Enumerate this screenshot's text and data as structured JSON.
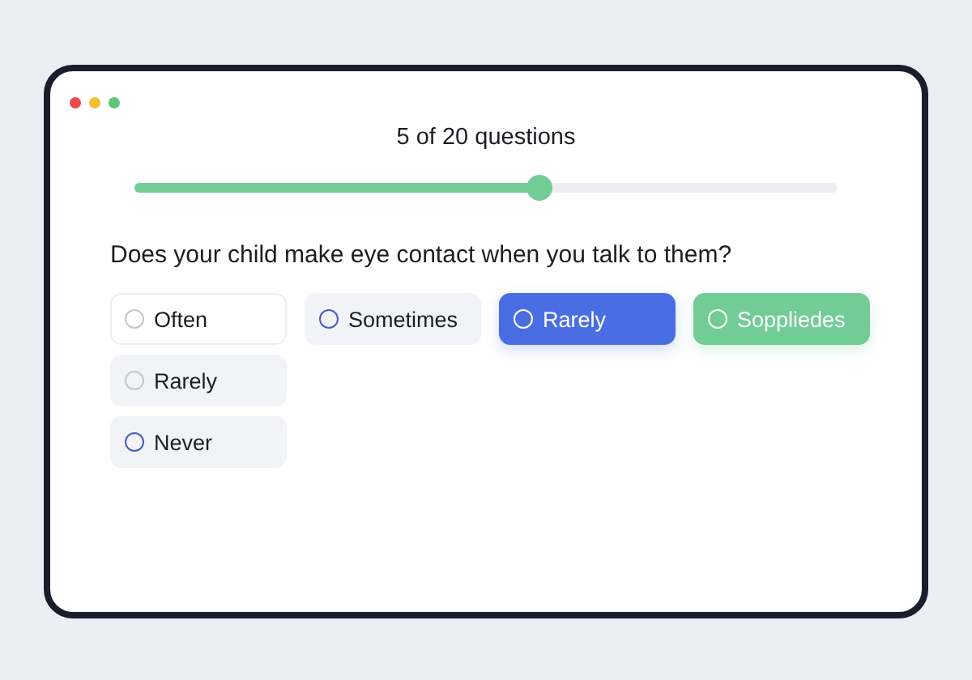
{
  "progress": {
    "label": "5 of 20 questions",
    "level": 0.575
  },
  "question": "Does your child make eye contact when you talk to them?",
  "option_rows": [
    [
      {
        "label": "Often",
        "kind": "outline",
        "color": "#c4c6cc",
        "selected": false
      },
      {
        "label": "Sometimes",
        "kind": "filled",
        "color": "#4a5bc4",
        "selected": false
      },
      {
        "label": "Rarely",
        "kind": "filled",
        "selected": true
      },
      {
        "label": "Soppliedes",
        "kind": "success",
        "selected": false
      }
    ],
    [
      {
        "label": "Rarely",
        "kind": "filled",
        "color": "#c4c6cc",
        "selected": false
      }
    ],
    [
      {
        "label": "Never",
        "kind": "filled",
        "color": "#4a5bc4",
        "selected": false
      }
    ]
  ]
}
